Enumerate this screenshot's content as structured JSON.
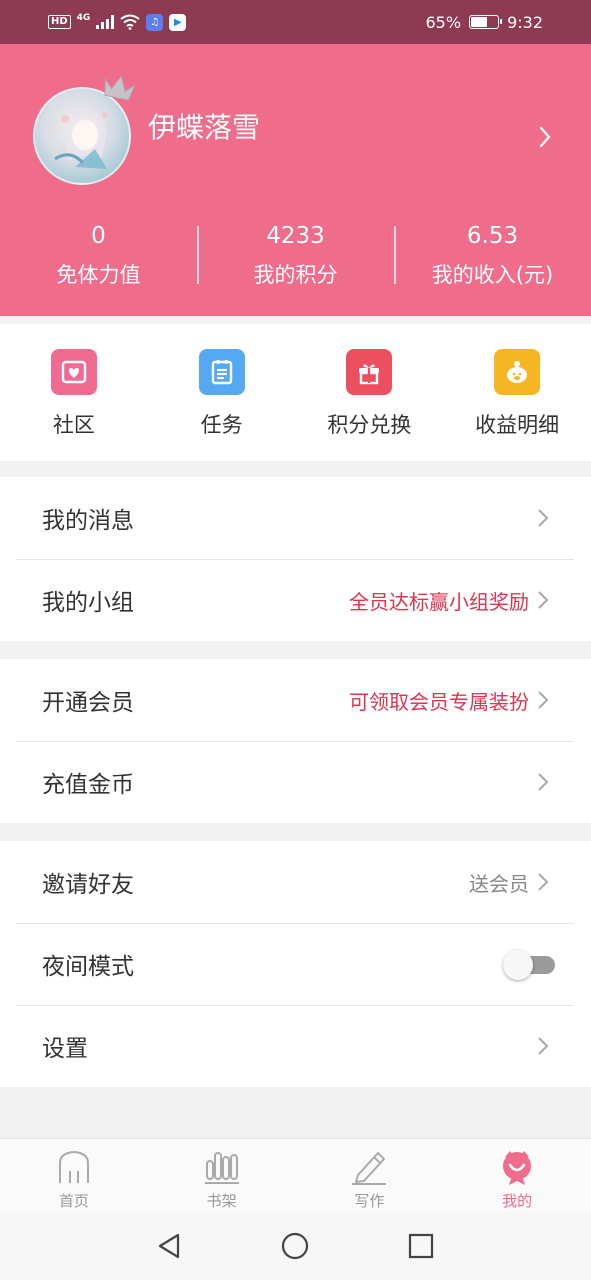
{
  "status_bar": {
    "hd": "HD",
    "network": "4G",
    "battery": "65%",
    "battery_level": 0.65,
    "time": "9:32"
  },
  "profile": {
    "username": "伊蝶落雪",
    "stats": [
      {
        "value": "0",
        "label": "免体力值"
      },
      {
        "value": "4233",
        "label": "我的积分"
      },
      {
        "value": "6.53",
        "label": "我的收入(元)"
      }
    ]
  },
  "actions": [
    {
      "label": "社区",
      "icon": "community-icon",
      "color": "#f06a92"
    },
    {
      "label": "任务",
      "icon": "task-icon",
      "color": "#55a9f3"
    },
    {
      "label": "积分兑换",
      "icon": "gift-icon",
      "color": "#ec5060"
    },
    {
      "label": "收益明细",
      "icon": "piggy-bank-icon",
      "color": "#f6b523"
    }
  ],
  "menu": {
    "group1": [
      {
        "label": "我的消息",
        "hint": ""
      },
      {
        "label": "我的小组",
        "hint": "全员达标赢小组奖励"
      }
    ],
    "group2": [
      {
        "label": "开通会员",
        "hint": "可领取会员专属装扮"
      },
      {
        "label": "充值金币",
        "hint": ""
      }
    ],
    "group3": [
      {
        "label": "邀请好友",
        "hint": "送会员"
      },
      {
        "label": "夜间模式",
        "toggle": false
      },
      {
        "label": "设置",
        "hint": ""
      }
    ]
  },
  "colors": {
    "header_bg": "#ef6d8b",
    "status_bg": "#8e3a52",
    "hint_red": "#e0344f",
    "tab_active": "#ef6d8b"
  },
  "tabbar": [
    {
      "label": "首页",
      "icon": "home-icon",
      "active": false
    },
    {
      "label": "书架",
      "icon": "bookshelf-icon",
      "active": false
    },
    {
      "label": "写作",
      "icon": "pencil-icon",
      "active": false
    },
    {
      "label": "我的",
      "icon": "profile-icon",
      "active": true
    }
  ]
}
